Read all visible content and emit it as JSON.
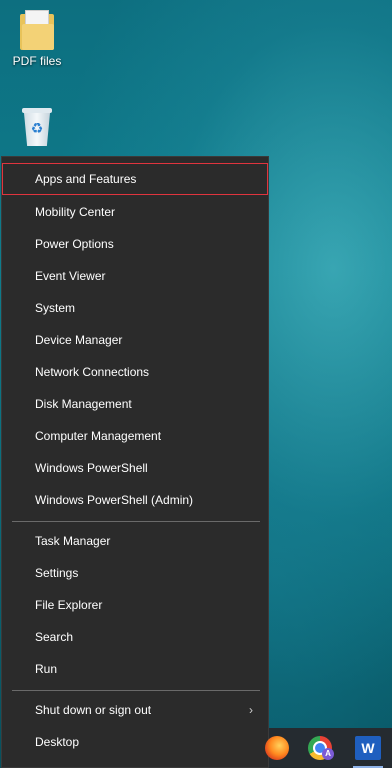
{
  "desktop": {
    "icons": [
      {
        "label": "PDF files",
        "icon": "folder-icon"
      },
      {
        "label": "",
        "icon": "recycle-bin-icon"
      }
    ]
  },
  "context_menu": {
    "group1": [
      {
        "label": "Apps and Features",
        "selected": true
      },
      {
        "label": "Mobility Center"
      },
      {
        "label": "Power Options"
      },
      {
        "label": "Event Viewer"
      },
      {
        "label": "System"
      },
      {
        "label": "Device Manager"
      },
      {
        "label": "Network Connections"
      },
      {
        "label": "Disk Management"
      },
      {
        "label": "Computer Management"
      },
      {
        "label": "Windows PowerShell"
      },
      {
        "label": "Windows PowerShell (Admin)"
      }
    ],
    "group2": [
      {
        "label": "Task Manager"
      },
      {
        "label": "Settings"
      },
      {
        "label": "File Explorer"
      },
      {
        "label": "Search"
      },
      {
        "label": "Run"
      }
    ],
    "group3": [
      {
        "label": "Shut down or sign out",
        "submenu_glyph": "›"
      },
      {
        "label": "Desktop"
      }
    ]
  },
  "taskbar": {
    "icons": [
      "firefox-icon",
      "chrome-icon",
      "word-icon"
    ],
    "chrome_badge": "A",
    "word_letter": "W"
  },
  "colors": {
    "menu_background": "#2b2b2b",
    "selection_border": "#e0343e",
    "separator": "#6a6a6a",
    "taskbar": "#252b30"
  }
}
